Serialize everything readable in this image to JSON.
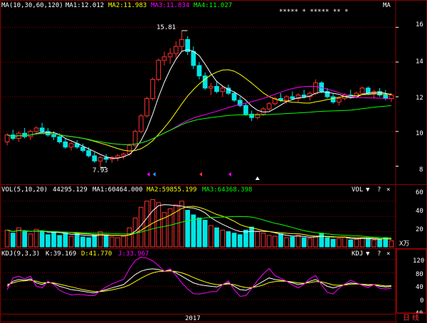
{
  "main": {
    "ma_title": "MA(10,30,60,120)",
    "ma1": "MA1:12.012",
    "ma2": "MA2:11.983",
    "ma3": "MA3:11.834",
    "ma4": "MA4:11.027",
    "masked_name": "***** * ***** ** *",
    "tag": "MA",
    "high_label": "15.81",
    "low_label": "7.93",
    "y_ticks": [
      "16",
      "14",
      "12",
      "10",
      "8"
    ]
  },
  "vol": {
    "title": "VOL(5,10,20)",
    "value": "44295.129",
    "ma1": "MA1:60464.000",
    "ma2": "MA2:59855.199",
    "ma3": "MA3:64368.398",
    "tag": "VOL",
    "unit": "X万",
    "y_ticks": [
      "60",
      "40",
      "20"
    ]
  },
  "kdj": {
    "title": "KDJ(9,3,3)",
    "k": "K:39.169",
    "d": "D:41.770",
    "j": "J:33.967",
    "tag": "KDJ",
    "y_ticks": [
      "120",
      "80",
      "40",
      "0",
      "-40"
    ]
  },
  "footer": {
    "year": "2017",
    "period_tab": "日线"
  },
  "buttons": {
    "dropdown": "▼",
    "help": "?",
    "close": "×"
  },
  "colors": {
    "up": "#ff3232",
    "down": "#00e6e6",
    "grid": "#8b0000",
    "ma1": "#ffffff",
    "ma2": "#ffff00",
    "ma3": "#ff00ff",
    "ma4": "#00ff00"
  },
  "chart_data": {
    "type": "candlestick",
    "price_range": [
      7,
      17
    ],
    "candles": [
      [
        9.4,
        9.9,
        9.2,
        9.8
      ],
      [
        9.8,
        10.1,
        9.5,
        9.6
      ],
      [
        9.6,
        10.0,
        9.4,
        9.9
      ],
      [
        9.9,
        10.2,
        9.6,
        9.7
      ],
      [
        9.7,
        10.1,
        9.5,
        10.0
      ],
      [
        10.0,
        10.3,
        9.8,
        10.2
      ],
      [
        10.2,
        10.5,
        9.9,
        10.0
      ],
      [
        10.0,
        10.2,
        9.7,
        9.8
      ],
      [
        9.8,
        10.0,
        9.5,
        9.7
      ],
      [
        9.7,
        9.9,
        9.3,
        9.4
      ],
      [
        9.4,
        9.6,
        9.0,
        9.1
      ],
      [
        9.1,
        9.4,
        8.9,
        9.3
      ],
      [
        9.3,
        9.5,
        9.0,
        9.1
      ],
      [
        9.1,
        9.3,
        8.8,
        8.9
      ],
      [
        8.9,
        9.1,
        8.5,
        8.6
      ],
      [
        8.6,
        8.8,
        8.2,
        8.3
      ],
      [
        8.3,
        8.6,
        7.93,
        8.5
      ],
      [
        8.5,
        8.7,
        8.2,
        8.4
      ],
      [
        8.4,
        8.6,
        8.2,
        8.5
      ],
      [
        8.5,
        8.7,
        8.3,
        8.6
      ],
      [
        8.6,
        8.8,
        8.4,
        8.7
      ],
      [
        8.7,
        9.3,
        8.6,
        9.2
      ],
      [
        9.2,
        10.1,
        9.1,
        10.0
      ],
      [
        10.0,
        11.0,
        9.9,
        10.9
      ],
      [
        10.9,
        12.0,
        10.8,
        11.9
      ],
      [
        11.9,
        13.1,
        11.8,
        13.0
      ],
      [
        13.0,
        14.2,
        12.9,
        14.1
      ],
      [
        14.1,
        14.6,
        13.8,
        14.3
      ],
      [
        14.3,
        14.8,
        13.9,
        14.5
      ],
      [
        14.5,
        15.2,
        14.2,
        14.9
      ],
      [
        14.9,
        15.81,
        14.6,
        15.3
      ],
      [
        15.3,
        15.5,
        14.4,
        14.6
      ],
      [
        14.6,
        14.9,
        13.6,
        13.8
      ],
      [
        13.8,
        14.0,
        13.0,
        13.2
      ],
      [
        13.2,
        13.4,
        12.4,
        12.5
      ],
      [
        12.5,
        12.8,
        12.1,
        12.6
      ],
      [
        12.6,
        12.9,
        12.2,
        12.3
      ],
      [
        12.3,
        12.6,
        12.0,
        12.5
      ],
      [
        12.5,
        12.7,
        12.1,
        12.2
      ],
      [
        12.2,
        12.3,
        11.7,
        11.8
      ],
      [
        11.8,
        12.0,
        11.4,
        11.5
      ],
      [
        11.5,
        11.6,
        10.9,
        11.0
      ],
      [
        11.0,
        11.2,
        10.6,
        10.8
      ],
      [
        10.8,
        11.1,
        10.7,
        11.0
      ],
      [
        11.0,
        11.4,
        10.9,
        11.3
      ],
      [
        11.3,
        11.7,
        11.2,
        11.6
      ],
      [
        11.6,
        12.0,
        11.5,
        11.9
      ],
      [
        11.9,
        12.2,
        11.7,
        11.8
      ],
      [
        11.8,
        12.1,
        11.6,
        12.0
      ],
      [
        12.0,
        12.3,
        11.8,
        11.9
      ],
      [
        11.9,
        12.2,
        11.7,
        12.1
      ],
      [
        12.1,
        12.4,
        11.9,
        12.0
      ],
      [
        12.0,
        12.3,
        11.8,
        12.2
      ],
      [
        12.2,
        13.0,
        12.1,
        12.8
      ],
      [
        12.8,
        12.9,
        12.2,
        12.3
      ],
      [
        12.3,
        12.5,
        11.9,
        12.0
      ],
      [
        12.0,
        12.2,
        11.6,
        11.7
      ],
      [
        11.7,
        12.0,
        11.5,
        11.9
      ],
      [
        11.9,
        12.2,
        11.8,
        12.1
      ],
      [
        12.1,
        12.4,
        11.9,
        12.0
      ],
      [
        12.0,
        12.3,
        11.9,
        12.2
      ],
      [
        12.2,
        12.6,
        12.1,
        12.5
      ],
      [
        12.5,
        12.6,
        12.1,
        12.2
      ],
      [
        12.2,
        12.4,
        11.9,
        12.3
      ],
      [
        12.3,
        12.5,
        12.0,
        12.1
      ],
      [
        12.1,
        12.4,
        11.8,
        11.9
      ],
      [
        11.9,
        12.2,
        11.7,
        12.1
      ]
    ],
    "volume_range": [
      0,
      70
    ],
    "volumes": [
      22,
      18,
      25,
      20,
      17,
      23,
      21,
      16,
      19,
      15,
      18,
      14,
      17,
      13,
      12,
      16,
      20,
      15,
      13,
      12,
      14,
      25,
      38,
      52,
      60,
      62,
      58,
      45,
      50,
      55,
      60,
      48,
      42,
      38,
      35,
      28,
      25,
      22,
      20,
      18,
      16,
      22,
      26,
      20,
      18,
      15,
      14,
      17,
      12,
      13,
      15,
      12,
      11,
      14,
      18,
      12,
      10,
      11,
      13,
      9,
      10,
      12,
      11,
      9,
      10,
      12,
      8
    ],
    "kdj_range": [
      -40,
      130
    ],
    "k": [
      40,
      55,
      60,
      58,
      62,
      50,
      45,
      52,
      48,
      40,
      35,
      30,
      28,
      25,
      22,
      20,
      25,
      30,
      35,
      40,
      45,
      60,
      75,
      85,
      90,
      92,
      90,
      85,
      88,
      80,
      70,
      60,
      50,
      45,
      42,
      40,
      38,
      45,
      50,
      40,
      30,
      28,
      35,
      45,
      55,
      65,
      60,
      58,
      55,
      50,
      45,
      48,
      55,
      60,
      50,
      40,
      35,
      40,
      45,
      50,
      48,
      45,
      42,
      45,
      40,
      38,
      39
    ],
    "d": [
      45,
      50,
      55,
      56,
      58,
      55,
      50,
      51,
      50,
      46,
      42,
      38,
      34,
      30,
      27,
      24,
      24,
      26,
      29,
      33,
      37,
      44,
      54,
      64,
      73,
      80,
      84,
      85,
      86,
      84,
      80,
      74,
      66,
      59,
      53,
      48,
      45,
      45,
      47,
      45,
      40,
      36,
      36,
      39,
      44,
      51,
      54,
      55,
      55,
      53,
      50,
      49,
      51,
      54,
      53,
      49,
      44,
      43,
      44,
      46,
      47,
      46,
      45,
      45,
      43,
      41,
      41.77
    ],
    "j": [
      30,
      65,
      70,
      62,
      70,
      40,
      35,
      55,
      45,
      28,
      20,
      14,
      16,
      15,
      12,
      12,
      27,
      38,
      47,
      54,
      61,
      92,
      117,
      127,
      124,
      116,
      102,
      85,
      92,
      72,
      50,
      32,
      18,
      17,
      20,
      24,
      24,
      45,
      56,
      30,
      10,
      12,
      33,
      57,
      77,
      93,
      72,
      64,
      55,
      44,
      35,
      46,
      63,
      72,
      44,
      22,
      17,
      34,
      47,
      58,
      50,
      43,
      36,
      45,
      34,
      32,
      33.967
    ]
  }
}
